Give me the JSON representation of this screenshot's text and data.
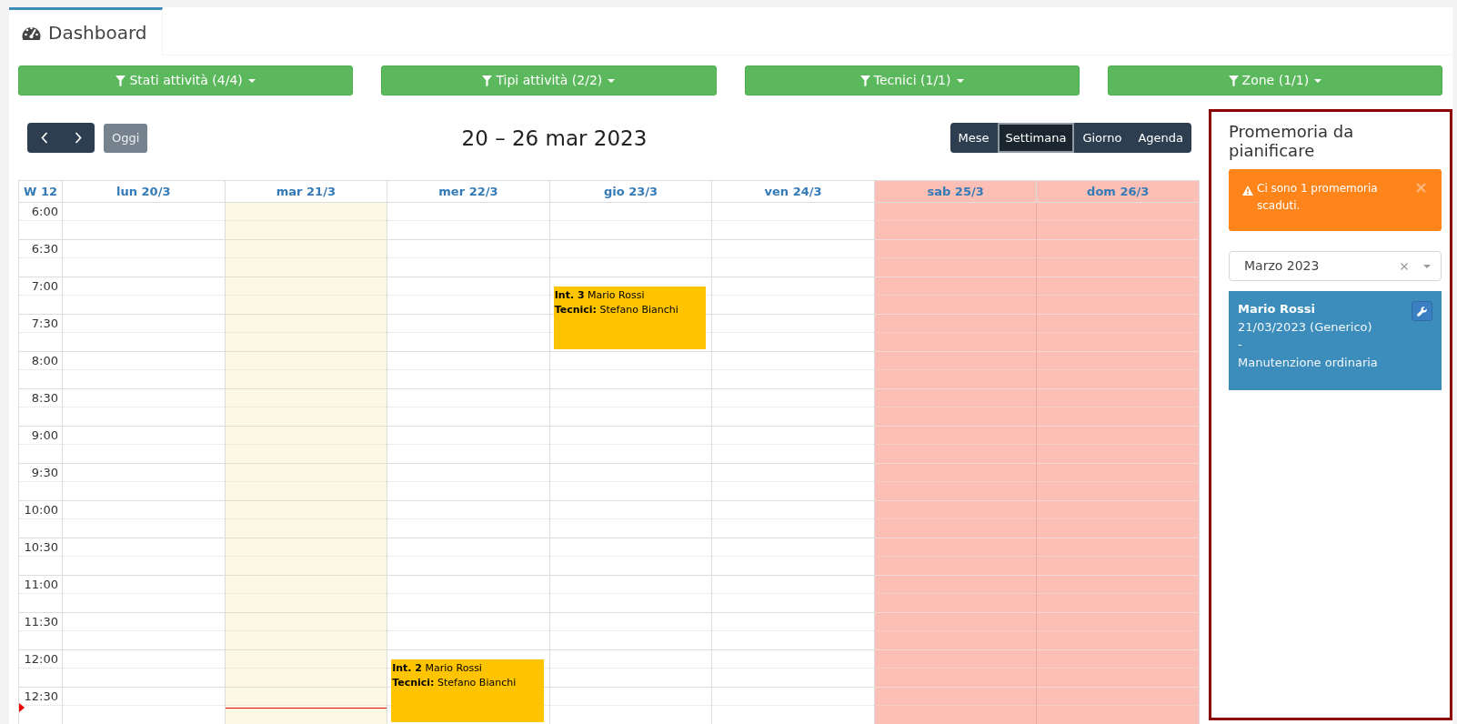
{
  "tabs": [
    {
      "label": "Dashboard",
      "selected": true
    }
  ],
  "filters": [
    {
      "label": "Stati attività (4/4)"
    },
    {
      "label": "Tipi attività (2/2)"
    },
    {
      "label": "Tecnici (1/1)"
    },
    {
      "label": "Zone (1/1)"
    }
  ],
  "toolbar": {
    "today_button": {
      "label": "Oggi",
      "disabled": true
    },
    "title": "20 – 26 mar 2023",
    "views": [
      {
        "label": "Mese",
        "selected": false
      },
      {
        "label": "Settimana",
        "selected": true
      },
      {
        "label": "Giorno",
        "selected": false
      },
      {
        "label": "Agenda",
        "selected": false
      }
    ]
  },
  "calendar": {
    "week_label": "W 12",
    "days": [
      {
        "label": "lun 20/3",
        "kind": "weekday"
      },
      {
        "label": "mar 21/3",
        "kind": "today"
      },
      {
        "label": "mer 22/3",
        "kind": "weekday"
      },
      {
        "label": "gio 23/3",
        "kind": "weekday"
      },
      {
        "label": "ven 24/3",
        "kind": "weekday"
      },
      {
        "label": "sab 25/3",
        "kind": "weekend"
      },
      {
        "label": "dom 26/3",
        "kind": "weekend"
      }
    ],
    "rows": [
      {
        "time": "6:00"
      },
      {
        "time": "6:30"
      },
      {
        "time": "7:00",
        "cells": [
          null,
          null,
          null,
          {
            "lines": [
              "**Int. 3** Mario Rossi",
              "**Tecnici:** Stefano Bianchi"
            ]
          },
          null,
          null,
          null
        ]
      },
      {
        "time": "7:30"
      },
      {
        "time": "8:00"
      },
      {
        "time": "8:30"
      },
      {
        "time": "9:00"
      },
      {
        "time": "9:30"
      },
      {
        "time": "10:00"
      },
      {
        "time": "10:30"
      },
      {
        "time": "11:00"
      },
      {
        "time": "11:30"
      },
      {
        "time": "12:00",
        "cells": [
          null,
          null,
          {
            "lines": [
              "**Int. 2** Mario Rossi",
              "**Tecnici:** Stefano Bianchi"
            ]
          },
          null,
          null,
          null,
          null
        ]
      },
      {
        "time": "12:30",
        "now": true
      }
    ]
  },
  "reminders_panel": {
    "title": "Promemoria da pianificare",
    "alert": {
      "message": "Ci sono 1 promemoria scaduti."
    },
    "month_select": {
      "value": "Marzo 2023"
    },
    "items": [
      {
        "name": "Mario Rossi",
        "lines": [
          "21/03/2023 (Generico)",
          "-",
          "Manutenzione ordinaria"
        ]
      }
    ]
  }
}
